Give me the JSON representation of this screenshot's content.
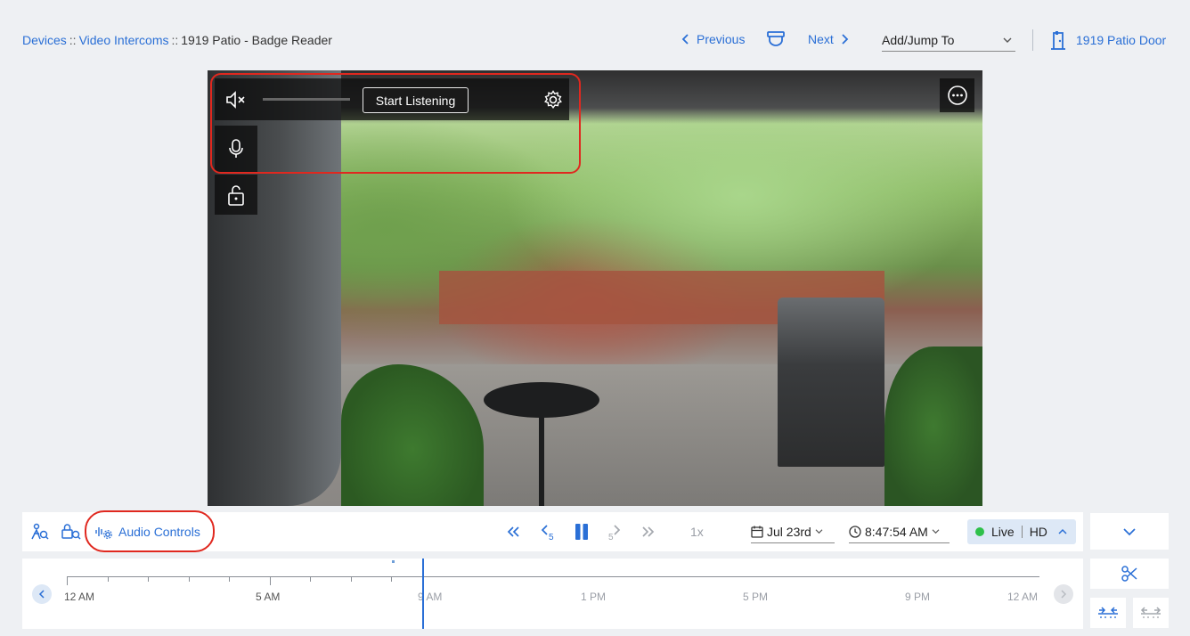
{
  "breadcrumb": {
    "devices": "Devices",
    "sep1": "::",
    "intercoms": "Video Intercoms",
    "sep2": "::",
    "current": "1919 Patio - Badge Reader"
  },
  "nav": {
    "previous": "Previous",
    "next": "Next",
    "jump_to": "Add/Jump To",
    "door_link": "1919 Patio Door"
  },
  "overlay": {
    "start_listening": "Start Listening",
    "icons": [
      "speaker-muted-icon",
      "microphone-icon",
      "unlock-icon",
      "gear-icon",
      "more-options-icon"
    ],
    "volume_level": 0
  },
  "controls": {
    "audio_controls": "Audio Controls",
    "speed": "1x",
    "date": "Jul 23rd",
    "time": "8:47:54 AM",
    "live": "Live",
    "quality": "HD"
  },
  "timeline": {
    "labels": [
      {
        "text": "12 AM",
        "muted": false
      },
      {
        "text": "5 AM",
        "muted": false
      },
      {
        "text": "9 AM",
        "muted": true
      },
      {
        "text": "1 PM",
        "muted": true
      },
      {
        "text": "5 PM",
        "muted": true
      },
      {
        "text": "9 PM",
        "muted": true
      },
      {
        "text": "12 AM",
        "muted": true
      }
    ]
  },
  "colors": {
    "accent": "#2a6fd6",
    "highlight": "#e0281f",
    "live_green": "#2ec04a",
    "background": "#eef0f3"
  }
}
